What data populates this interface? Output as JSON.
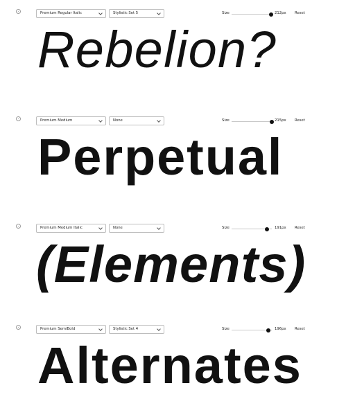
{
  "size_label": "Size",
  "reset_label": "Reset",
  "specimens": [
    {
      "font": "Premium Regular Italic",
      "set": "Stylistic Set 5",
      "size": "212px",
      "slider_fraction": 0.98,
      "text": "Rebelion?"
    },
    {
      "font": "Premium Medium",
      "set": "None",
      "size": "215px",
      "slider_fraction": 1.0,
      "text": "Perpetual"
    },
    {
      "font": "Premium Medium Italic",
      "set": "None",
      "size": "191px",
      "slider_fraction": 0.88,
      "text": "(Elements)"
    },
    {
      "font": "Premium SemiBold",
      "set": "Stylistic Set 4",
      "size": "196px",
      "slider_fraction": 0.91,
      "text": "Alternates"
    }
  ]
}
